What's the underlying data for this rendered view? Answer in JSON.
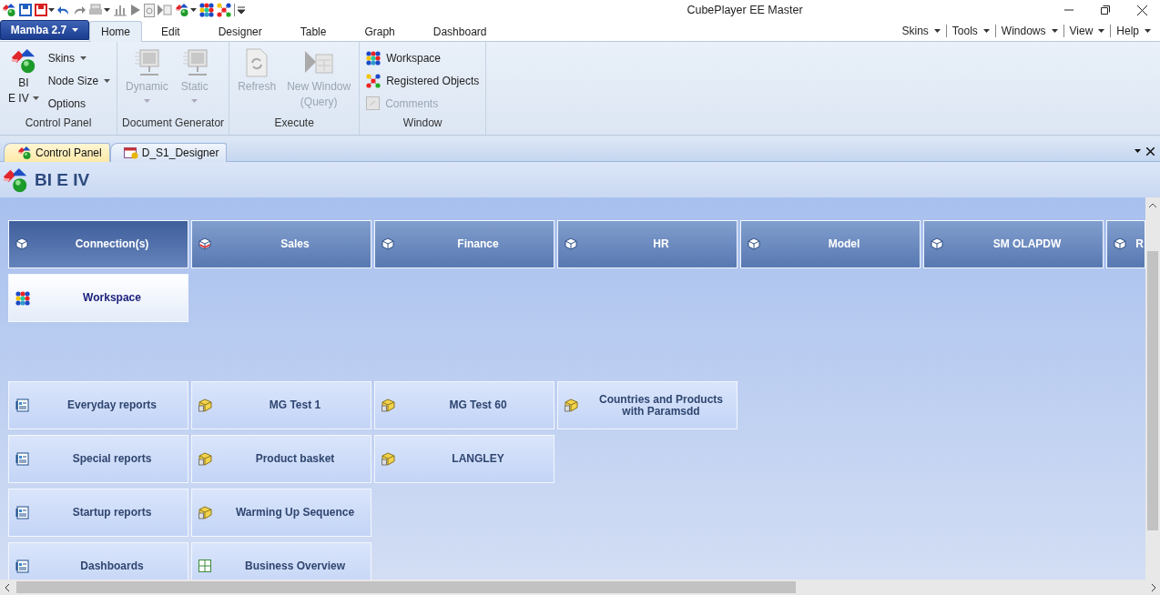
{
  "window": {
    "title": "CubePlayer EE Master"
  },
  "ribbon": {
    "app_button": "Mamba 2.7",
    "tabs": [
      {
        "label": "Home",
        "selected": true
      },
      {
        "label": "Edit",
        "selected": false
      },
      {
        "label": "Designer",
        "selected": false
      },
      {
        "label": "Table",
        "selected": false
      },
      {
        "label": "Graph",
        "selected": false
      },
      {
        "label": "Dashboard",
        "selected": false
      }
    ],
    "menus": [
      "Skins",
      "Tools",
      "Windows",
      "View",
      "Help"
    ],
    "groups": [
      {
        "label": "Control Panel",
        "items": [
          {
            "kind": "large",
            "lines": [
              "BI",
              "E IV"
            ],
            "dropdown": true,
            "disabled": false
          },
          {
            "kind": "small",
            "lines": [
              "Skins"
            ],
            "dropdown": true,
            "disabled": false
          },
          {
            "kind": "small",
            "lines": [
              "Node Size"
            ],
            "dropdown": true,
            "disabled": false
          },
          {
            "kind": "small",
            "lines": [
              "Options"
            ],
            "dropdown": false,
            "disabled": false
          }
        ]
      },
      {
        "label": "Document Generator",
        "items": [
          {
            "kind": "large",
            "lines": [
              "Dynamic"
            ],
            "dropdown": true,
            "disabled": true
          },
          {
            "kind": "large",
            "lines": [
              "Static"
            ],
            "dropdown": true,
            "disabled": true
          }
        ]
      },
      {
        "label": "Execute",
        "items": [
          {
            "kind": "large",
            "lines": [
              "Refresh"
            ],
            "dropdown": false,
            "disabled": true
          },
          {
            "kind": "large",
            "lines": [
              "New Window",
              "(Query)"
            ],
            "dropdown": false,
            "disabled": true
          }
        ]
      },
      {
        "label": "Window",
        "items": [
          {
            "kind": "small",
            "lines": [
              "Workspace"
            ],
            "dropdown": false,
            "disabled": false
          },
          {
            "kind": "small",
            "lines": [
              "Registered Objects"
            ],
            "dropdown": false,
            "disabled": false
          },
          {
            "kind": "small",
            "lines": [
              "Comments"
            ],
            "dropdown": false,
            "disabled": true
          }
        ]
      }
    ]
  },
  "document_tabs": [
    {
      "label": "Control Panel",
      "selected": true
    },
    {
      "label": "D_S1_Designer",
      "selected": false
    }
  ],
  "panel": {
    "title": "BI E IV",
    "sections": [
      {
        "rows": [
          [
            {
              "kind": "cube",
              "label": "Connection(s)",
              "selected": true
            },
            {
              "kind": "sales",
              "label": "Sales",
              "selected": false
            },
            {
              "kind": "cube",
              "label": "Finance",
              "selected": false
            },
            {
              "kind": "cube",
              "label": "HR",
              "selected": false
            },
            {
              "kind": "cube",
              "label": "Model",
              "selected": false
            },
            {
              "kind": "cube",
              "label": "SM OLAPDW",
              "selected": false
            },
            {
              "kind": "cube",
              "label": "R",
              "selected": false
            }
          ],
          [
            {
              "kind": "workspace",
              "label": "Workspace",
              "selected": false
            }
          ]
        ]
      },
      {
        "rows": [
          [
            {
              "kind": "report",
              "label": "Everyday reports",
              "selected": false
            },
            {
              "kind": "query",
              "label": "MG Test 1",
              "selected": false
            },
            {
              "kind": "query",
              "label": "MG Test 60",
              "selected": false
            },
            {
              "kind": "query",
              "label": "Countries and Products with Paramsdd",
              "selected": false
            }
          ],
          [
            {
              "kind": "report",
              "label": "Special reports",
              "selected": false
            },
            {
              "kind": "query",
              "label": "Product basket",
              "selected": false
            },
            {
              "kind": "query",
              "label": "LANGLEY",
              "selected": false
            }
          ],
          [
            {
              "kind": "report",
              "label": "Startup reports",
              "selected": false
            },
            {
              "kind": "query",
              "label": "Warming Up Sequence",
              "selected": false
            }
          ],
          [
            {
              "kind": "report",
              "label": "Dashboards",
              "selected": false
            },
            {
              "kind": "dashboard",
              "label": "Business Overview",
              "selected": false
            }
          ]
        ]
      }
    ]
  }
}
